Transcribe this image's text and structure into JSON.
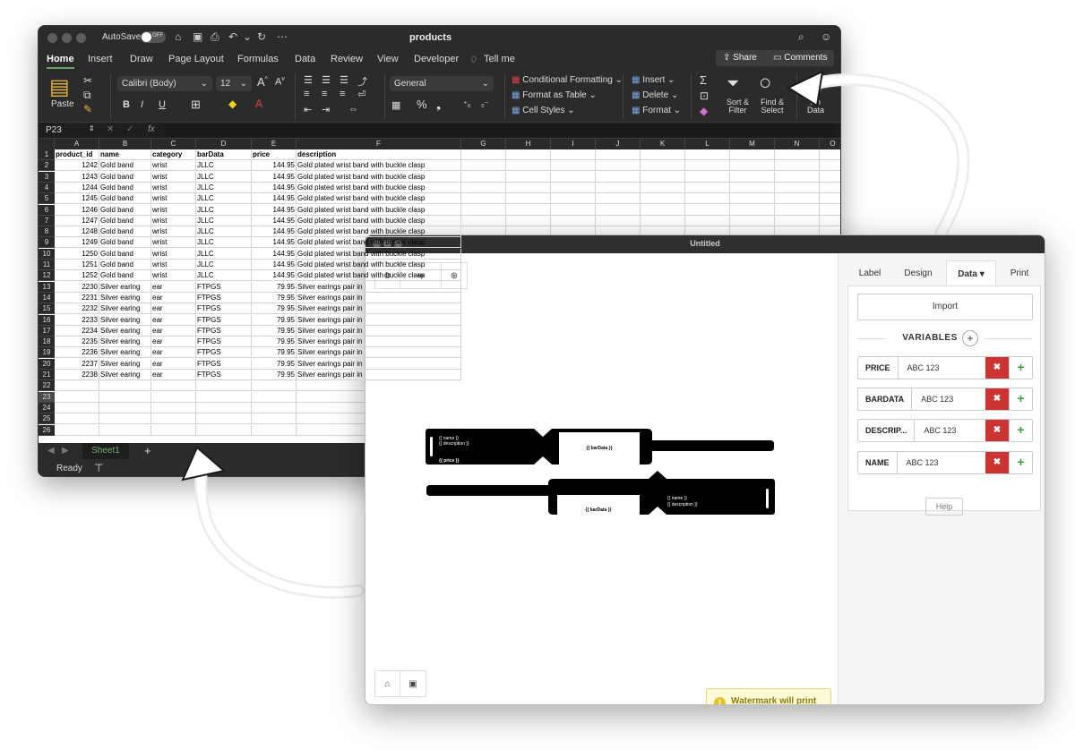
{
  "excel": {
    "autosave_label": "AutoSave",
    "autosave_state": "OFF",
    "doc_name": "products",
    "tabs": [
      "Home",
      "Insert",
      "Draw",
      "Page Layout",
      "Formulas",
      "Data",
      "Review",
      "View",
      "Developer",
      "Tell me"
    ],
    "share_label": "Share",
    "comments_label": "Comments",
    "ribbon": {
      "paste": "Paste",
      "font": "Calibri (Body)",
      "font_size": "12",
      "number_format": "General",
      "conditional_formatting": "Conditional Formatting",
      "format_as_table": "Format as Table",
      "cell_styles": "Cell Styles",
      "insert": "Insert",
      "delete": "Delete",
      "format": "Format",
      "sort_filter_1": "Sort &",
      "sort_filter_2": "Filter",
      "find_select_1": "Find &",
      "find_select_2": "Select",
      "analyze_1": "An",
      "analyze_2": "Data",
      "bold": "B",
      "italic": "I",
      "underline": "U"
    },
    "name_box": "P23",
    "fx": "fx",
    "col_letters": [
      "A",
      "B",
      "C",
      "D",
      "E",
      "F",
      "G",
      "H",
      "I",
      "J",
      "K",
      "L",
      "M",
      "N",
      "O"
    ],
    "headers": [
      "product_id",
      "name",
      "category",
      "barData",
      "price",
      "description"
    ],
    "rows": [
      [
        "1242",
        "Gold band",
        "wrist",
        "JLLC",
        "144.95",
        "Gold plated wrist band with buckle clasp"
      ],
      [
        "1243",
        "Gold band",
        "wrist",
        "JLLC",
        "144.95",
        "Gold plated wrist band with buckle clasp"
      ],
      [
        "1244",
        "Gold band",
        "wrist",
        "JLLC",
        "144.95",
        "Gold plated wrist band with buckle clasp"
      ],
      [
        "1245",
        "Gold band",
        "wrist",
        "JLLC",
        "144.95",
        "Gold plated wrist band with buckle clasp"
      ],
      [
        "1246",
        "Gold band",
        "wrist",
        "JLLC",
        "144.95",
        "Gold plated wrist band with buckle clasp"
      ],
      [
        "1247",
        "Gold band",
        "wrist",
        "JLLC",
        "144.95",
        "Gold plated wrist band with buckle clasp"
      ],
      [
        "1248",
        "Gold band",
        "wrist",
        "JLLC",
        "144.95",
        "Gold plated wrist band with buckle clasp"
      ],
      [
        "1249",
        "Gold band",
        "wrist",
        "JLLC",
        "144.95",
        "Gold plated wrist band with buckle clasp"
      ],
      [
        "1250",
        "Gold band",
        "wrist",
        "JLLC",
        "144.95",
        "Gold plated wrist band with buckle clasp"
      ],
      [
        "1251",
        "Gold band",
        "wrist",
        "JLLC",
        "144.95",
        "Gold plated wrist band with buckle clasp"
      ],
      [
        "1252",
        "Gold band",
        "wrist",
        "JLLC",
        "144.95",
        "Gold plated wrist band with buckle clasp"
      ],
      [
        "2230",
        "Silver earing",
        "ear",
        "FTPGS",
        "79.95",
        "Silver earings pair in"
      ],
      [
        "2231",
        "Silver earing",
        "ear",
        "FTPGS",
        "79.95",
        "Silver earings pair in"
      ],
      [
        "2232",
        "Silver earing",
        "ear",
        "FTPGS",
        "79.95",
        "Silver earings pair in"
      ],
      [
        "2233",
        "Silver earing",
        "ear",
        "FTPGS",
        "79.95",
        "Silver earings pair in"
      ],
      [
        "2234",
        "Silver earing",
        "ear",
        "FTPGS",
        "79.95",
        "Silver earings pair in"
      ],
      [
        "2235",
        "Silver earing",
        "ear",
        "FTPGS",
        "79.95",
        "Silver earings pair in"
      ],
      [
        "2236",
        "Silver earing",
        "ear",
        "FTPGS",
        "79.95",
        "Silver earings pair in"
      ],
      [
        "2237",
        "Silver earing",
        "ear",
        "FTPGS",
        "79.95",
        "Silver earings pair in"
      ],
      [
        "2238",
        "Silver earing",
        "ear",
        "FTPGS",
        "79.95",
        "Silver earings pair in"
      ]
    ],
    "sheet_tab": "Sheet1",
    "status": "Ready"
  },
  "designer": {
    "title": "Untitled",
    "tabs": [
      "Label",
      "Design",
      "Data",
      "Print"
    ],
    "active_tab": "Data",
    "import_label": "Import",
    "variables_label": "VARIABLES",
    "variables": [
      {
        "name": "PRICE",
        "value": "ABC 123"
      },
      {
        "name": "BARDATA",
        "value": "ABC 123"
      },
      {
        "name": "DESCRIP...",
        "value": "ABC 123"
      },
      {
        "name": "NAME",
        "value": "ABC 123"
      }
    ],
    "help_label": "Help",
    "watermark_text": "Watermark will print",
    "band_text": {
      "name": "{{ name }}",
      "description": "{{ description }}",
      "price": "{{ price }}",
      "bardata": "{{ barData }}"
    }
  },
  "colors": {
    "excel_bg": "#1e1e1e",
    "accent_green": "#6aa36f",
    "delete_red": "#cc3333",
    "add_green": "#3aa43a",
    "watermark_bg": "#fefbd9"
  }
}
